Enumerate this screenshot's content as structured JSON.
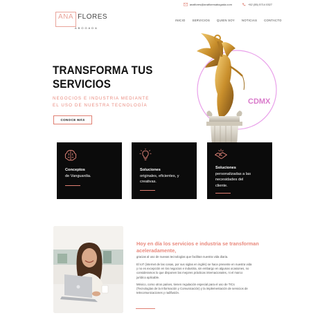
{
  "colors": {
    "accent": "#e9897d",
    "card_bg": "#0b0b0b",
    "text": "#111111"
  },
  "topbar": {
    "email": "anaflores@anafloresabogada.com",
    "email_icon": "mail-icon",
    "phone": "+52 (55) 5714 0327",
    "phone_icon": "phone-icon"
  },
  "logo": {
    "first": "ANA",
    "last": "FLORES",
    "subtitle": "ABOGADA"
  },
  "nav": {
    "items": [
      "INICIO",
      "SERVICIOS",
      "QUIEN SOY",
      "NOTICIAS",
      "CONTACTO"
    ]
  },
  "hero": {
    "title_line1": "TRANSFORMA TUS",
    "title_line2": "SERVICIOS",
    "subtitle_line1": "NEGOCIOS E INDUSTRIA MEDIANTE",
    "subtitle_line2": "EL USO DE NUESTRA TECNOLOGÍA",
    "button": "CONOCE MÁS",
    "badge": "CDMX"
  },
  "cards": [
    {
      "icon": "brain-icon",
      "title": "Conceptos",
      "body_lines": [
        "de Vanguardia."
      ]
    },
    {
      "icon": "lightbulb-icon",
      "title": "Soluciones",
      "body_lines": [
        "originales, eficientes, y",
        "creativas."
      ]
    },
    {
      "icon": "handshake-icon",
      "title": "Soluciones",
      "body_lines": [
        "personalizadas a las",
        "necesidades del",
        "cliente."
      ]
    }
  ],
  "about": {
    "heading_line1": "Hoy en día los servicios e industria se transforman",
    "heading_line2": "aceleradamente,",
    "p1": "gracias al uso de nuevas tecnologías que facilitan nuestra vida diaria.",
    "p2_lines": [
      "El IoT (internet de las cosas, por sus siglas en inglés) se hace presente en nuestra vida",
      "y no es excepción en los negocios e industria, sin embargo en algunas ocasiones, no",
      "consideramos lo que disponen las mejores prácticas internacionales, ni el marco",
      "jurídico aplicable."
    ],
    "p3_lines": [
      "México, como otros países, tienen regulación especial para el uso de TICs",
      "(Tecnologías de la Información y Comunicación) y la implementación de servicios de",
      "telecomunicaciones y radifusión."
    ]
  }
}
